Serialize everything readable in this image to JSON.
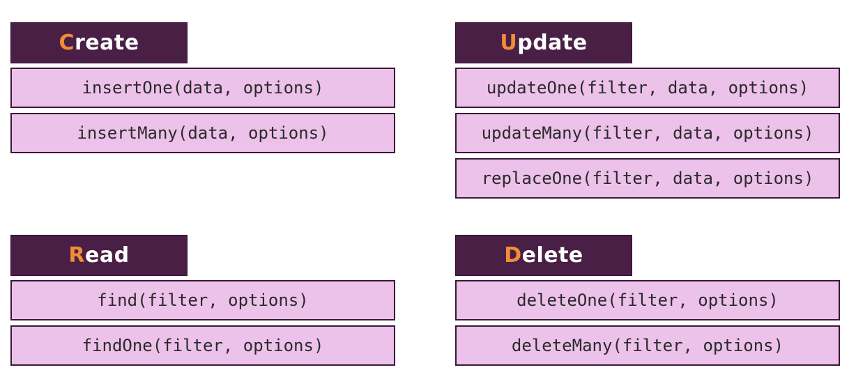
{
  "colors": {
    "header_bg": "#4a1f46",
    "initial_letter": "#f28c38",
    "method_bg": "#ecc1ea",
    "method_border": "#3a1838"
  },
  "create": {
    "initial": "C",
    "rest": "reate",
    "methods": [
      "insertOne(data, options)",
      "insertMany(data, options)"
    ]
  },
  "update": {
    "initial": "U",
    "rest": "pdate",
    "methods": [
      "updateOne(filter, data, options)",
      "updateMany(filter, data, options)",
      "replaceOne(filter, data, options)"
    ]
  },
  "read": {
    "initial": "R",
    "rest": "ead",
    "methods": [
      "find(filter, options)",
      "findOne(filter, options)"
    ]
  },
  "delete": {
    "initial": "D",
    "rest": "elete",
    "methods": [
      "deleteOne(filter, options)",
      "deleteMany(filter, options)"
    ]
  }
}
